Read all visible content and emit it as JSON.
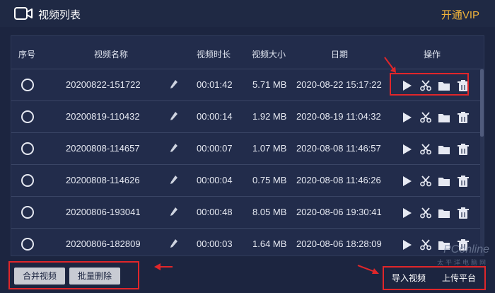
{
  "window": {
    "title": "视频列表",
    "vip_label": "开通VIP"
  },
  "table": {
    "columns": [
      "序号",
      "视频名称",
      "视频时长",
      "视频大小",
      "日期",
      "操作"
    ],
    "rows": [
      {
        "name": "20200822-151722",
        "duration": "00:01:42",
        "size": "5.71 MB",
        "date": "2020-08-22 15:17:22"
      },
      {
        "name": "20200819-110432",
        "duration": "00:00:14",
        "size": "1.92 MB",
        "date": "2020-08-19 11:04:32"
      },
      {
        "name": "20200808-114657",
        "duration": "00:00:07",
        "size": "1.07 MB",
        "date": "2020-08-08 11:46:57"
      },
      {
        "name": "20200808-114626",
        "duration": "00:00:04",
        "size": "0.75 MB",
        "date": "2020-08-08 11:46:26"
      },
      {
        "name": "20200806-193041",
        "duration": "00:00:48",
        "size": "8.05 MB",
        "date": "2020-08-06 19:30:41"
      },
      {
        "name": "20200806-182809",
        "duration": "00:00:03",
        "size": "1.64 MB",
        "date": "2020-08-06 18:28:09"
      }
    ],
    "row_actions": [
      "play-icon",
      "scissors-icon",
      "folder-icon",
      "trash-icon"
    ]
  },
  "footer": {
    "merge_label": "合并视频",
    "batch_delete_label": "批量删除",
    "import_label": "导入视频",
    "upload_label": "上传平台"
  },
  "watermark": {
    "brand": "PConline",
    "sub": "太平洋电脑网"
  },
  "colors": {
    "background": "#1c2540",
    "panel": "#222c4b",
    "accent_vip": "#f0b33a",
    "highlight": "#e0262a"
  }
}
